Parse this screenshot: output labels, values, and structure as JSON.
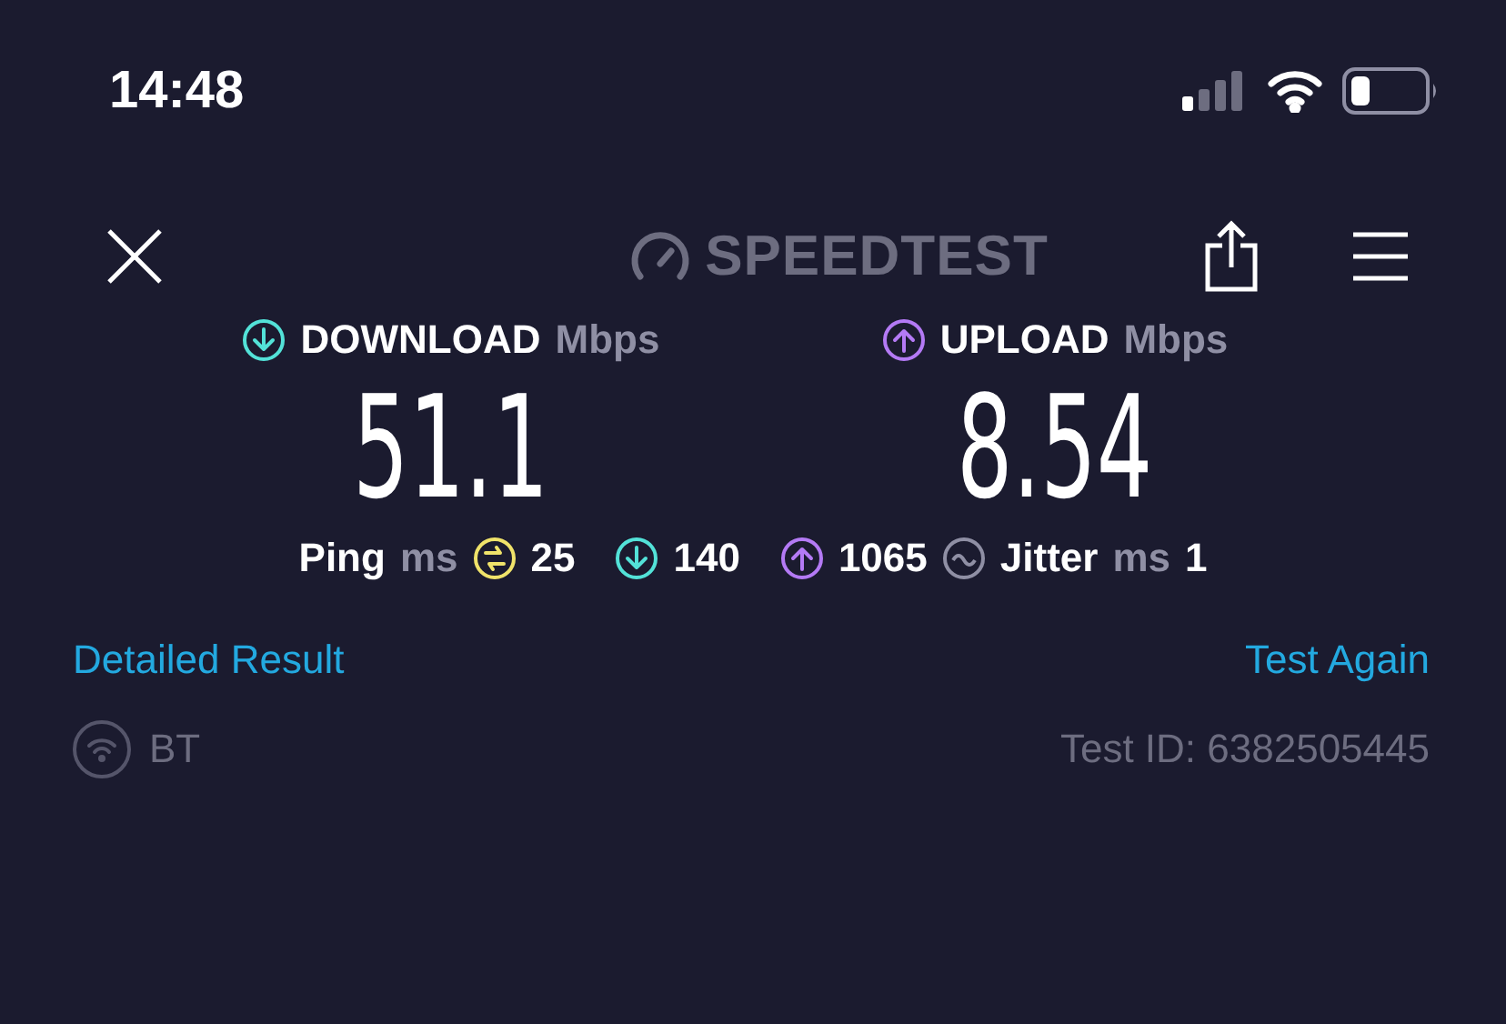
{
  "status_bar": {
    "time": "14:48"
  },
  "header": {
    "logo": "SPEEDTEST"
  },
  "metrics": [
    {
      "kind": "download",
      "label": "DOWNLOAD",
      "unit": "Mbps",
      "value": "51.1"
    },
    {
      "kind": "upload",
      "label": "UPLOAD",
      "unit": "Mbps",
      "value": "8.54"
    }
  ],
  "latency": {
    "label": "Ping",
    "unit": "ms",
    "items": [
      {
        "kind": "idle",
        "value": "25"
      },
      {
        "kind": "download",
        "value": "140"
      },
      {
        "kind": "upload",
        "value": "1065"
      }
    ],
    "jitter": {
      "label": "Jitter",
      "unit": "ms",
      "value": "1"
    }
  },
  "links": [
    "Detailed Result",
    "Test Again"
  ],
  "footer": {
    "provider": "BT",
    "test_id": "Test ID: 6382505445"
  }
}
